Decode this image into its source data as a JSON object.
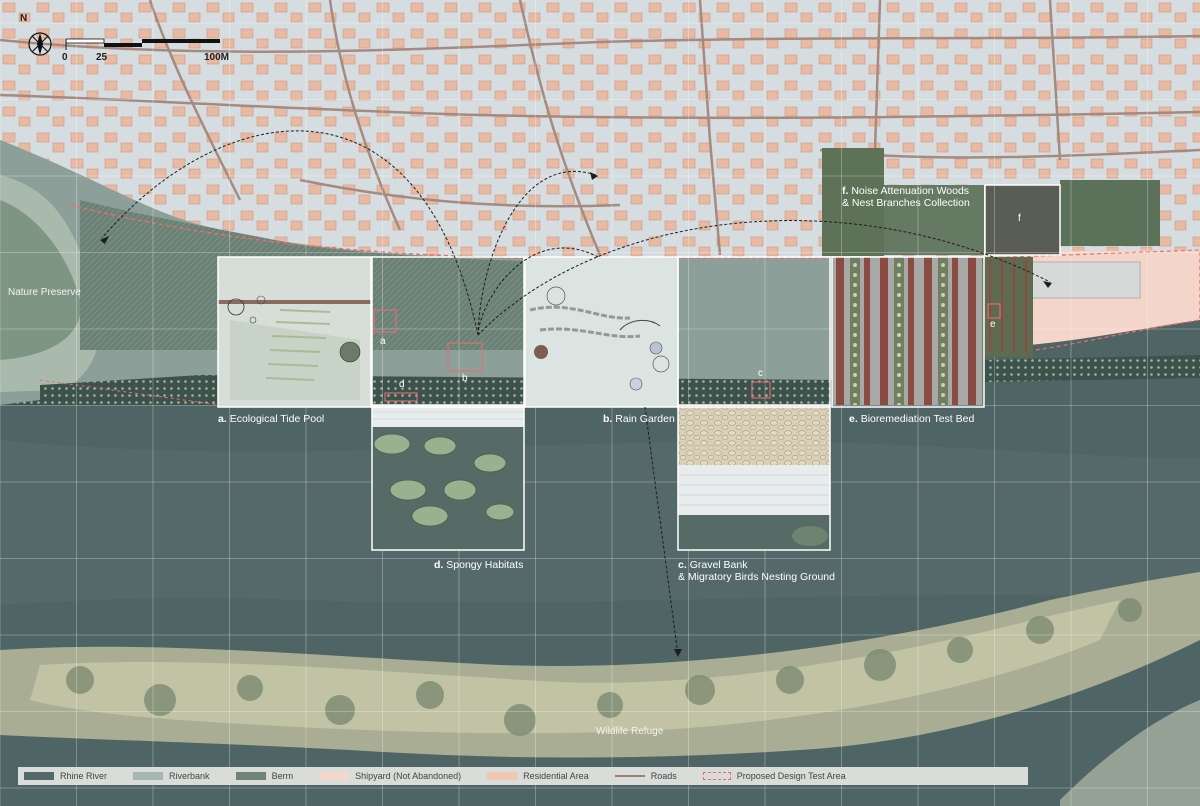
{
  "compass": {
    "letter": "N",
    "icon": "compass-icon"
  },
  "scale_bar": {
    "labels": [
      "0",
      "25",
      "100M"
    ]
  },
  "place_labels": {
    "nature_preserve": "Nature Preserve",
    "wildlife_refuge": "Wildlife Refuge"
  },
  "panels": [
    {
      "letter": "a.",
      "title": "Ecological Tide Pool"
    },
    {
      "letter": "b.",
      "title": "Rain Garden"
    },
    {
      "letter": "c.",
      "title": "Gravel Bank",
      "title2": "& Migratory Birds Nesting Ground"
    },
    {
      "letter": "d.",
      "title": "Spongy Habitats"
    },
    {
      "letter": "e.",
      "title": "Bioremediation Test Bed"
    },
    {
      "letter": "f.",
      "title": "Noise Attenuation Woods",
      "title2": "& Nest Branches Collection"
    }
  ],
  "site_markers": [
    "a",
    "b",
    "c",
    "d",
    "e",
    "f"
  ],
  "legend": [
    {
      "label": "Rhine River",
      "color": "#56696a"
    },
    {
      "label": "Riverbank",
      "color": "#a7b7b2"
    },
    {
      "label": "Berm",
      "color": "#6f8479"
    },
    {
      "label": "Shipyard (Not Abandoned)",
      "color": "#f4d6cc"
    },
    {
      "label": "Residential Area",
      "color": "#f2c7b1"
    },
    {
      "label": "Roads",
      "color": "#9a8076"
    },
    {
      "label": "Proposed Design Test Area",
      "color": "#e86e6e"
    }
  ]
}
